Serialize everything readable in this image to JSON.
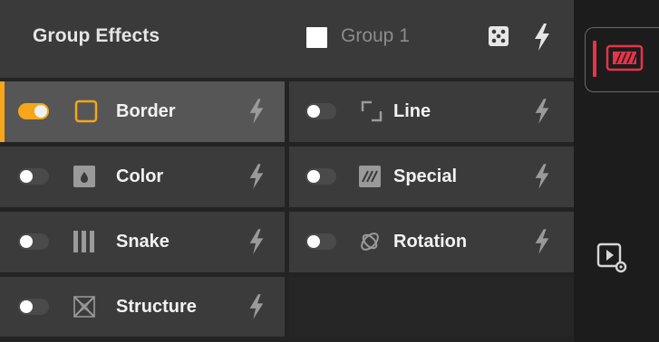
{
  "panel": {
    "title": "Group Effects",
    "group_name": "Group 1",
    "group_color": "#ffffff"
  },
  "colors": {
    "accent": "#f5a61b",
    "brand_red": "#e8334a"
  },
  "effects": [
    {
      "label": "Border",
      "enabled": true,
      "icon": "border-square-icon"
    },
    {
      "label": "Line",
      "enabled": false,
      "icon": "line-corners-icon"
    },
    {
      "label": "Color",
      "enabled": false,
      "icon": "color-drop-icon"
    },
    {
      "label": "Special",
      "enabled": false,
      "icon": "special-stripes-icon"
    },
    {
      "label": "Snake",
      "enabled": false,
      "icon": "snake-bars-icon"
    },
    {
      "label": "Rotation",
      "enabled": false,
      "icon": "rotation-rings-icon"
    },
    {
      "label": "Structure",
      "enabled": false,
      "icon": "structure-icon"
    }
  ],
  "side": {
    "logo_icon": "striped-badge-icon",
    "settings_icon": "play-settings-icon"
  }
}
